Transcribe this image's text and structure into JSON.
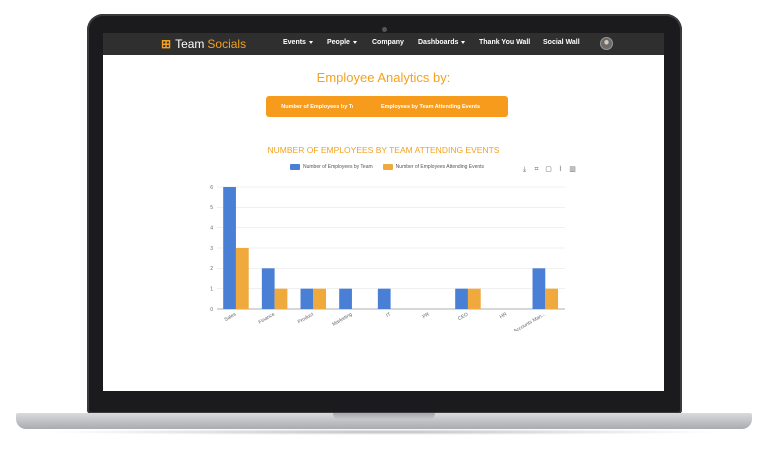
{
  "nav": {
    "brand_primary": "Team",
    "brand_secondary": "Socials",
    "items": [
      {
        "label": "Events",
        "dropdown": true
      },
      {
        "label": "People",
        "dropdown": true
      },
      {
        "label": "Company",
        "dropdown": false
      },
      {
        "label": "Dashboards",
        "dropdown": true
      },
      {
        "label": "Thank You Wall",
        "dropdown": false
      },
      {
        "label": "Social Wall",
        "dropdown": false
      }
    ]
  },
  "page": {
    "title": "Employee Analytics by:",
    "button_by_team": "Number of Employees by Team",
    "button_attending": "Employees by Team Attending Events"
  },
  "colors": {
    "accent": "#f79b1c",
    "series_team": "#4a7fd6",
    "series_attending": "#f0a93d",
    "nav_bg": "#2f2f30"
  },
  "toolbox": [
    "download-icon",
    "crop-icon",
    "restore-icon",
    "line-chart-icon",
    "bar-chart-icon"
  ],
  "chart_data": {
    "type": "bar",
    "title": "NUMBER OF EMPLOYEES BY TEAM ATTENDING EVENTS",
    "categories": [
      "Sales",
      "Finance",
      "Product",
      "Marketing",
      "IT",
      "PR",
      "CEO",
      "HR",
      "Accounts Man..."
    ],
    "series": [
      {
        "name": "Number of Employees by Team",
        "values": [
          6,
          2,
          1,
          1,
          1,
          0,
          1,
          0,
          2
        ]
      },
      {
        "name": "Number of Employees Attending Events",
        "values": [
          3,
          1,
          1,
          0,
          0,
          0,
          1,
          0,
          1
        ]
      }
    ],
    "y_ticks": [
      "0",
      "1",
      "2",
      "3",
      "4",
      "5",
      "6"
    ],
    "ylim": [
      0,
      6
    ],
    "grid": true,
    "legend_position": "top"
  }
}
